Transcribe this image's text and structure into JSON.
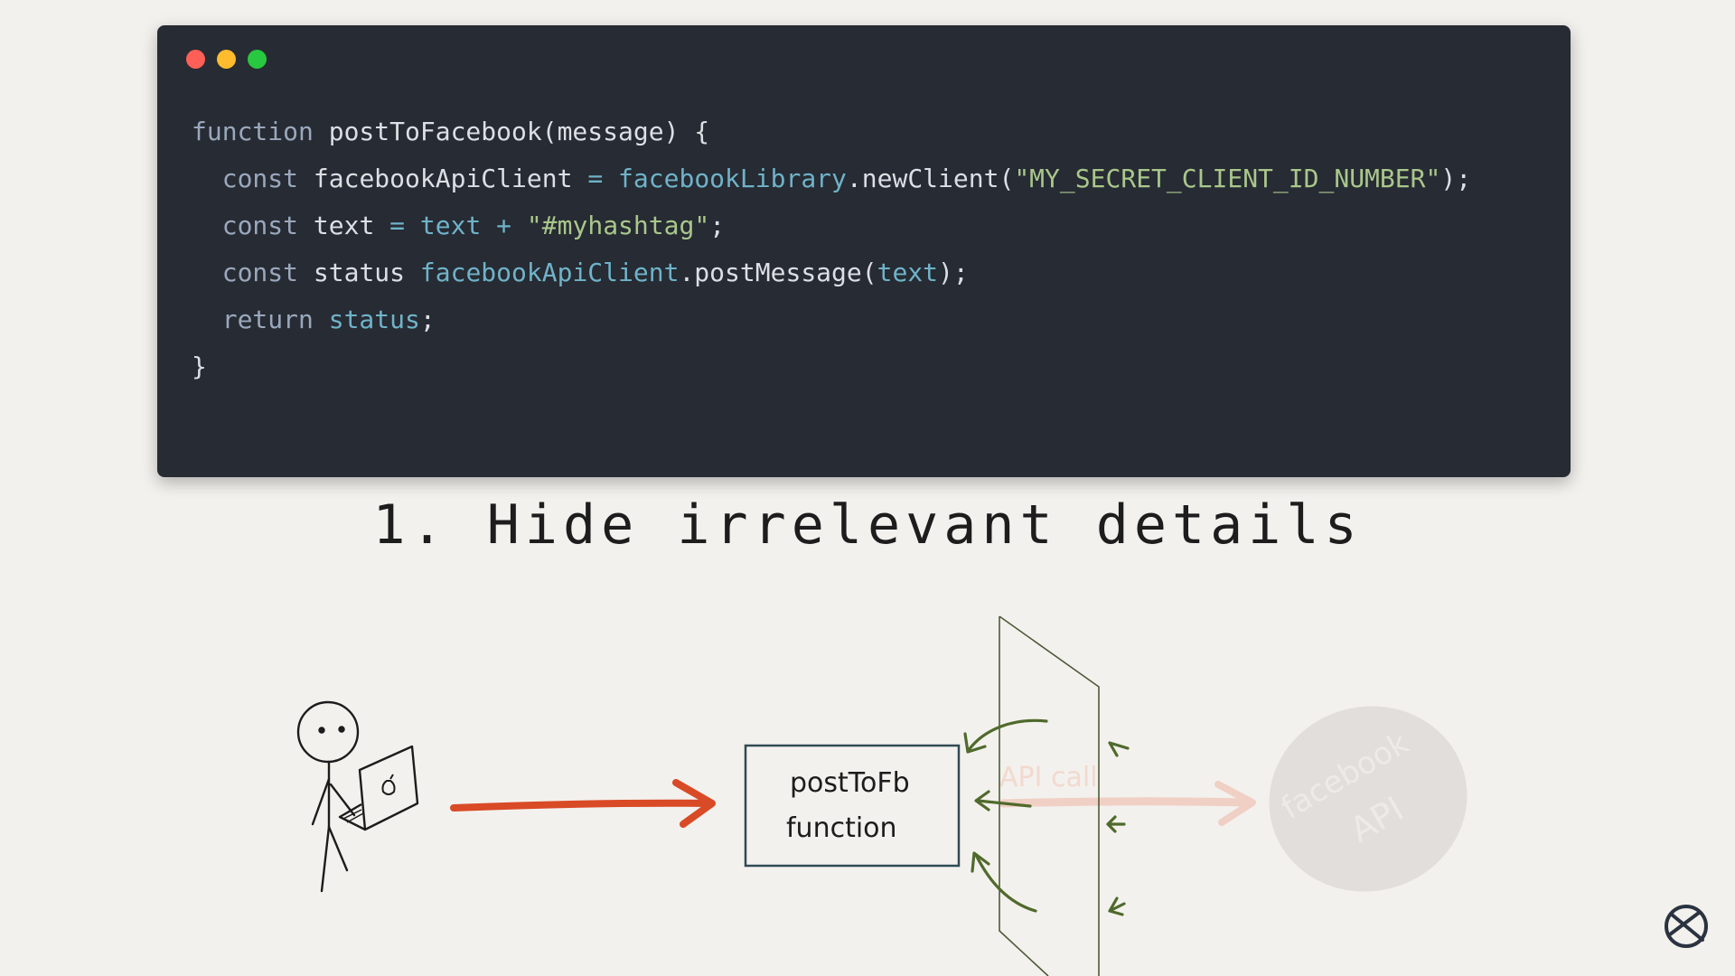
{
  "code_window": {
    "lines": [
      [
        [
          "kw",
          "function"
        ],
        [
          "fn",
          " postToFacebook(message) {"
        ]
      ],
      [
        [
          "kw",
          "  const"
        ],
        [
          "fn",
          " facebookApiClient "
        ],
        [
          "op",
          "="
        ],
        [
          "id",
          " facebookLibrary"
        ],
        [
          "fn",
          ".newClient("
        ],
        [
          "str",
          "\"MY_SECRET_CLIENT_ID_NUMBER\""
        ],
        [
          "fn",
          ");"
        ]
      ],
      [
        [
          "kw",
          "  const"
        ],
        [
          "fn",
          " text "
        ],
        [
          "op",
          "="
        ],
        [
          "id",
          " text"
        ],
        [
          "op",
          " +"
        ],
        [
          "str",
          " \"#myhashtag\""
        ],
        [
          "fn",
          ";"
        ]
      ],
      [
        [
          "kw",
          "  const"
        ],
        [
          "fn",
          " status "
        ],
        [
          "id",
          "facebookApiClient"
        ],
        [
          "fn",
          ".postMessage("
        ],
        [
          "id",
          "text"
        ],
        [
          "fn",
          ");"
        ]
      ],
      [
        [
          "kw",
          "  return"
        ],
        [
          "id",
          " status"
        ],
        [
          "fn",
          ";"
        ]
      ],
      [
        [
          "fn",
          "}"
        ]
      ]
    ]
  },
  "title": "1. Hide irrelevant details",
  "diagram": {
    "function_box_line1": "postToFb",
    "function_box_line2": "function",
    "api_call_label": "API call",
    "cloud_line1": "facebook",
    "cloud_line2": "API"
  },
  "colors": {
    "red_arrow": "#d94a26",
    "green_arrow": "#4f6a2c",
    "faded_arrow": "#f0c2b4",
    "cloud": "#dcdad6"
  },
  "icons": {
    "brand_logo": "logo-icon",
    "laptop": "laptop-icon"
  }
}
